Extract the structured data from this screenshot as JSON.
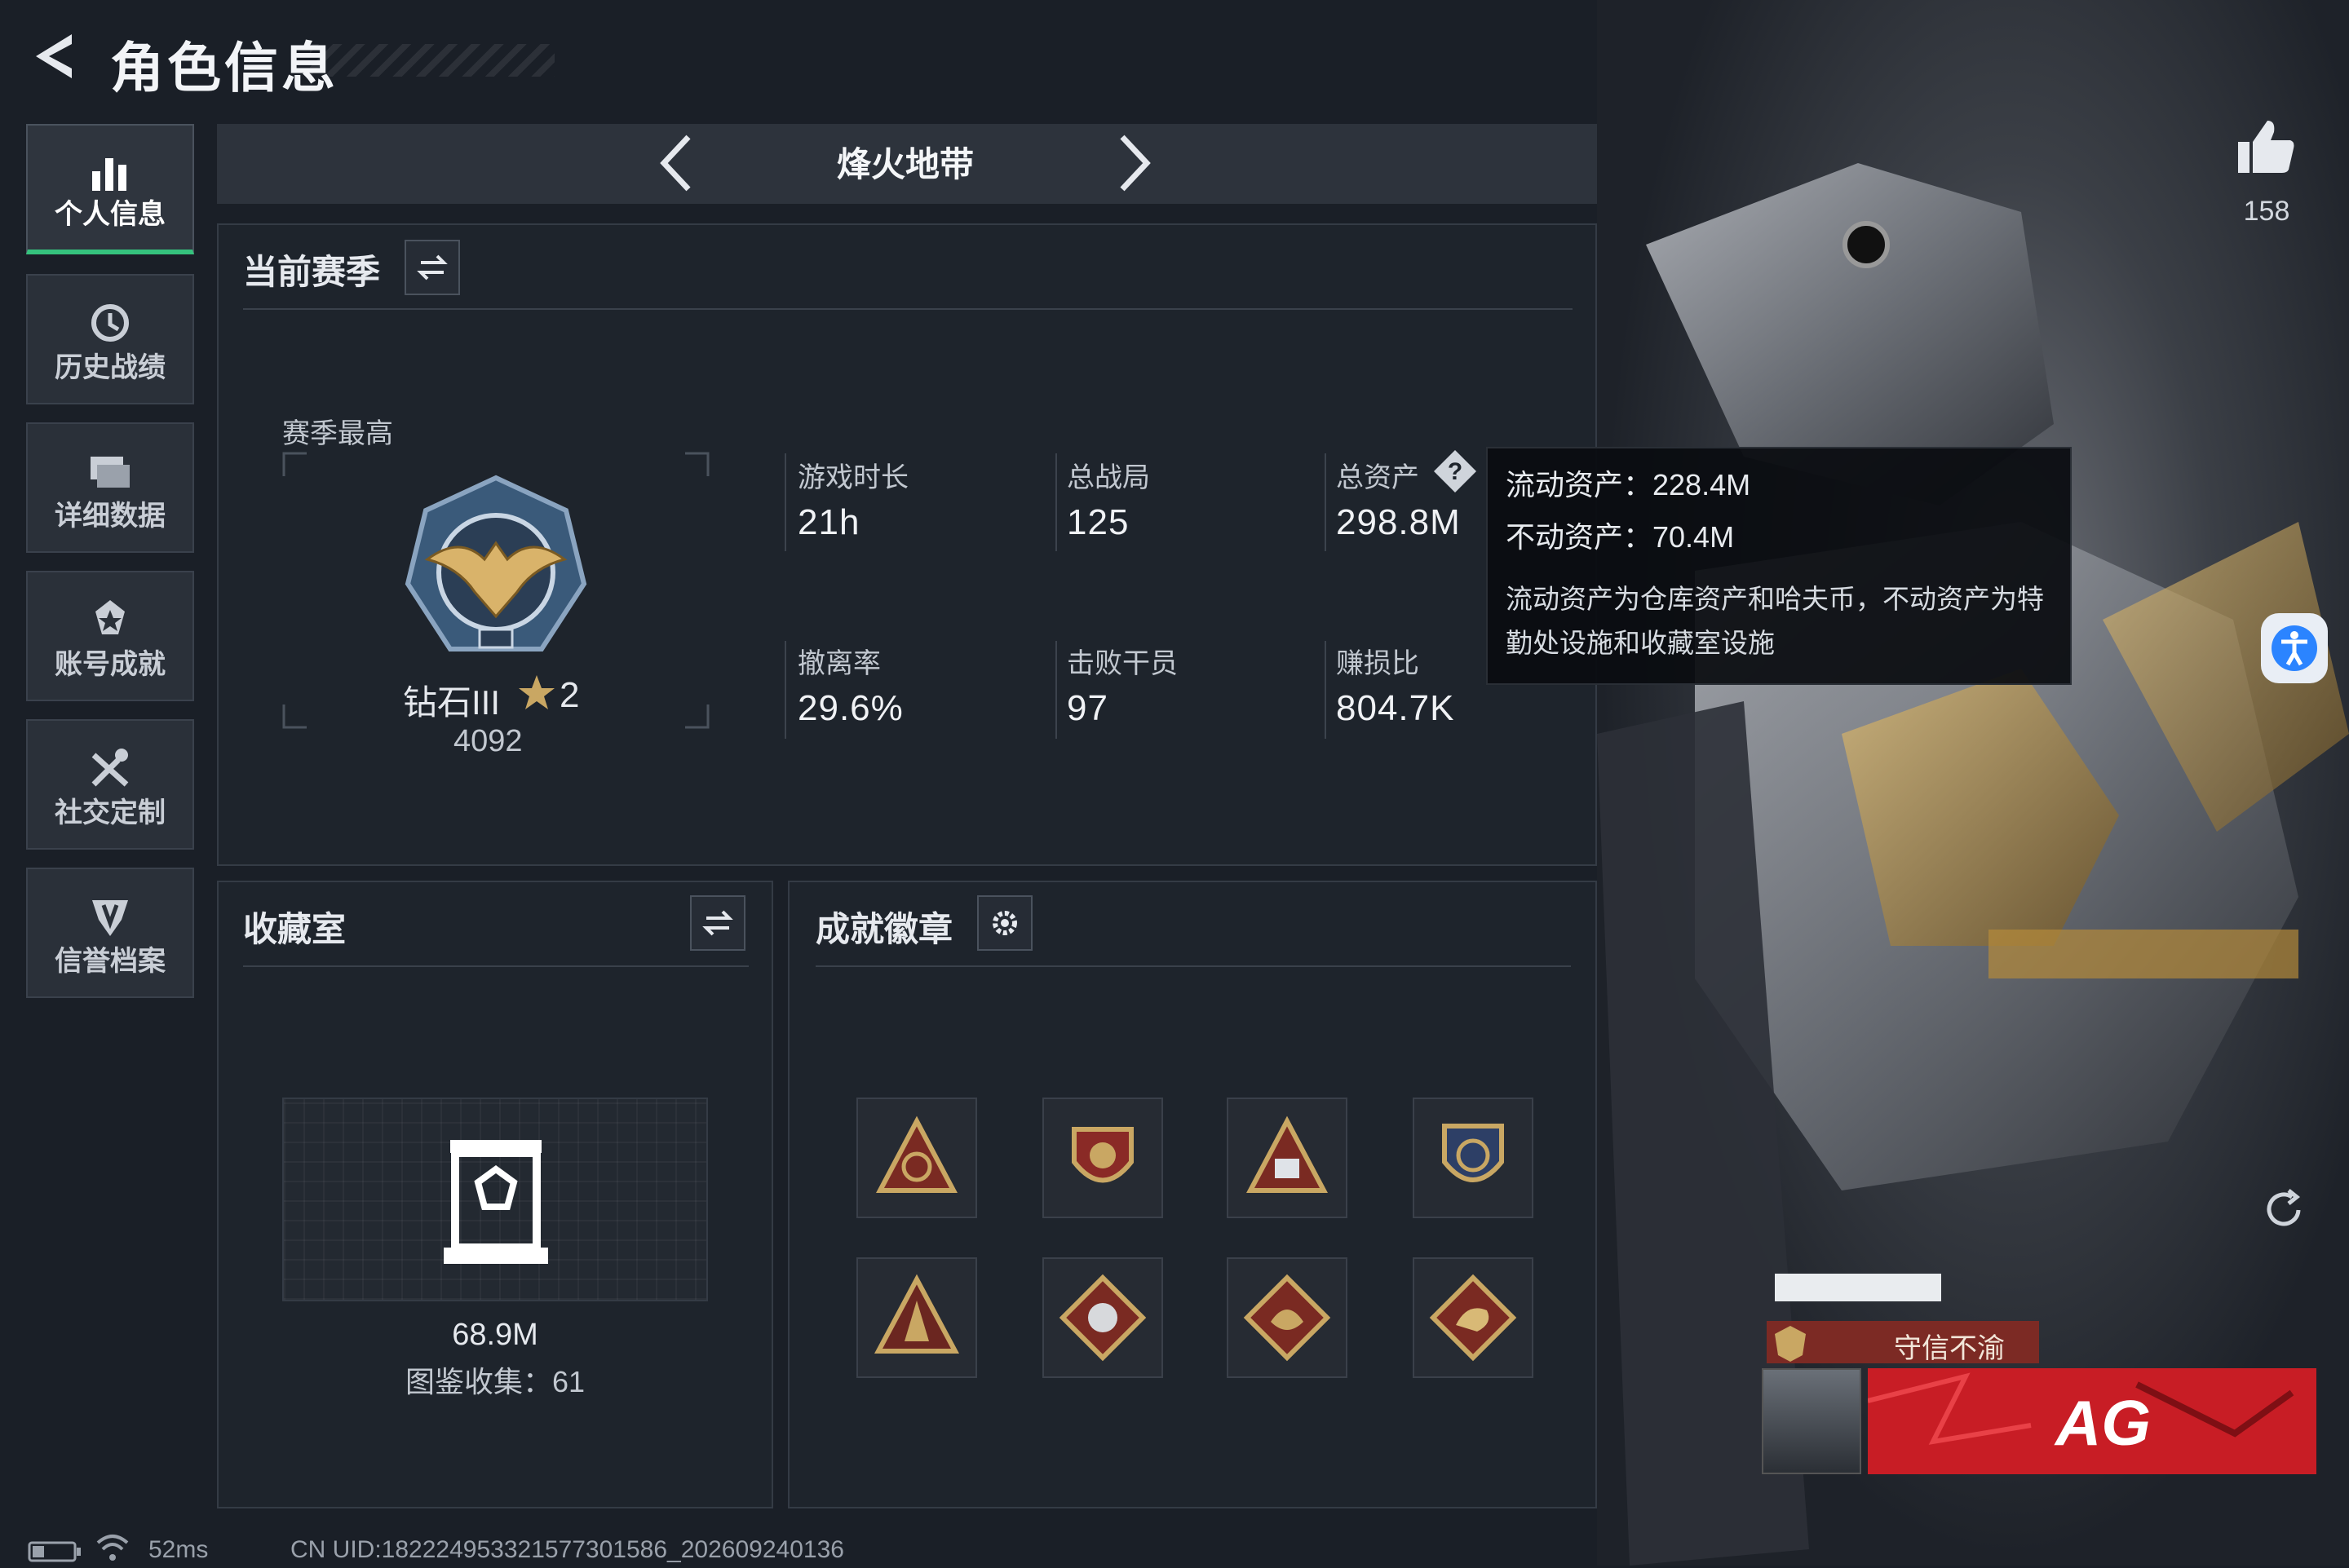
{
  "header": {
    "title": "角色信息"
  },
  "likes": {
    "count": "158"
  },
  "nav": [
    {
      "label": "个人信息",
      "icon": "bar-chart-icon"
    },
    {
      "label": "历史战绩",
      "icon": "history-clock-icon"
    },
    {
      "label": "详细数据",
      "icon": "folders-icon"
    },
    {
      "label": "账号成就",
      "icon": "achievement-medal-icon"
    },
    {
      "label": "社交定制",
      "icon": "tools-icon"
    },
    {
      "label": "信誉档案",
      "icon": "shield-icon"
    }
  ],
  "mode": {
    "title": "烽火地带"
  },
  "season": {
    "title": "当前赛季",
    "best_label": "赛季最高",
    "rank_name": "钻石III",
    "rank_stars": "2",
    "rank_score": "4092",
    "stats": [
      {
        "label": "游戏时长",
        "value": "21h"
      },
      {
        "label": "总战局",
        "value": "125"
      },
      {
        "label": "总资产",
        "value": "298.8M"
      },
      {
        "label": "撤离率",
        "value": "29.6%"
      },
      {
        "label": "击败干员",
        "value": "97"
      },
      {
        "label": "赚损比",
        "value": "804.7K"
      }
    ]
  },
  "tooltip": {
    "liquid": "流动资产：228.4M",
    "fixed": "不动资产：70.4M",
    "desc": "流动资产为仓库资产和哈夫币，不动资产为特勤处设施和收藏室设施"
  },
  "collection": {
    "title": "收藏室",
    "value": "68.9M",
    "catalog": "图鉴收集：61"
  },
  "badges": {
    "title": "成就徽章",
    "items": [
      "badge-1",
      "badge-2",
      "badge-3",
      "badge-4",
      "badge-5",
      "badge-6",
      "badge-7",
      "badge-8"
    ]
  },
  "player_card": {
    "motto": "守信不渝",
    "team_logo": "AG"
  },
  "footer": {
    "ping": "52ms",
    "uid": "CN UID:182224953321577301586_202609240136"
  },
  "colors": {
    "accent_green": "#35c27d",
    "panel_bg": "#1e242c",
    "red_card": "#c81d25",
    "access_blue": "#2b84ff"
  }
}
